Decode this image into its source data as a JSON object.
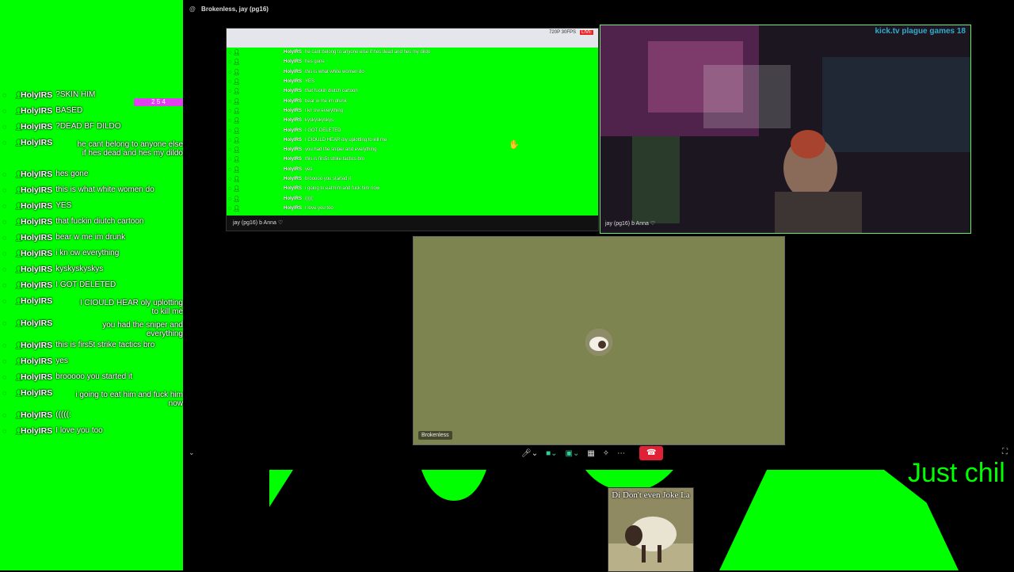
{
  "window": {
    "title": "Brokenless, jay (pg16)"
  },
  "left_chat": {
    "badge_text": "2 5 4",
    "messages": [
      {
        "user": "HolyIRS",
        "text": "?SKIN HIM"
      },
      {
        "user": "HolyIRS",
        "text": "BASED"
      },
      {
        "user": "HolyIRS",
        "text": "?DEAD BF DILDO"
      },
      {
        "user": "HolyIRS",
        "text": "he cant belong to anyone else if hes dead and hes my dildo"
      },
      {
        "user": "HolyIRS",
        "text": "hes gone"
      },
      {
        "user": "HolyIRS",
        "text": "this is what white women do"
      },
      {
        "user": "HolyIRS",
        "text": "YES"
      },
      {
        "user": "HolyIRS",
        "text": "that fuckin diutch cartoon"
      },
      {
        "user": "HolyIRS",
        "text": "bear w me im drunk"
      },
      {
        "user": "HolyIRS",
        "text": "i kn ow everything"
      },
      {
        "user": "HolyIRS",
        "text": "kyskyskyskys"
      },
      {
        "user": "HolyIRS",
        "text": "I GOT DELETED"
      },
      {
        "user": "HolyIRS",
        "text": "I CIOULD HEAR oly uplotting to kill me"
      },
      {
        "user": "HolyIRS",
        "text": "you had the sniper and everything"
      },
      {
        "user": "HolyIRS",
        "text": "this is firs5t strike tactics bro"
      },
      {
        "user": "HolyIRS",
        "text": "yes"
      },
      {
        "user": "HolyIRS",
        "text": "brooooo you started it"
      },
      {
        "user": "HolyIRS",
        "text": "i going to eat him and fuck him now"
      },
      {
        "user": "HolyIRS",
        "text": "(((((:"
      },
      {
        "user": "HolyIRS",
        "text": "I love you too"
      }
    ]
  },
  "shared_screen": {
    "fps_text": "720P 30FPS",
    "live_text": "LIVE",
    "footer_label": "jay (pg16) b Anna ♡",
    "messages": [
      {
        "user": "HolyIRS",
        "text": "he cant belong to anyone else if hes dead and hes my dildo"
      },
      {
        "user": "HolyIRS",
        "text": "hes gone"
      },
      {
        "user": "HolyIRS",
        "text": "this is what white women do"
      },
      {
        "user": "HolyIRS",
        "text": "YES"
      },
      {
        "user": "HolyIRS",
        "text": "that fuckin diutch cartoon"
      },
      {
        "user": "HolyIRS",
        "text": "bear w me im drunk"
      },
      {
        "user": "HolyIRS",
        "text": "i kn ow everything"
      },
      {
        "user": "HolyIRS",
        "text": "kyskyskyskys"
      },
      {
        "user": "HolyIRS",
        "text": "I GOT DELETED"
      },
      {
        "user": "HolyIRS",
        "text": "I CIOULD HEAR oly uplotting to kill me"
      },
      {
        "user": "HolyIRS",
        "text": "you had the sniper and everything"
      },
      {
        "user": "HolyIRS",
        "text": "this is firs5t strike tactics bro"
      },
      {
        "user": "HolyIRS",
        "text": "yes"
      },
      {
        "user": "HolyIRS",
        "text": "brooooo you started it"
      },
      {
        "user": "HolyIRS",
        "text": "i going to eat him and fuck him now"
      },
      {
        "user": "HolyIRS",
        "text": "(((((:"
      },
      {
        "user": "HolyIRS",
        "text": "I love you too"
      }
    ]
  },
  "webcam": {
    "label": "jay (pg16) b Anna ♡",
    "overlay_text": "kick.tv plague games 18"
  },
  "participant_tile": {
    "name": "Brokenless"
  },
  "overlay": {
    "banner_text": "Just chil",
    "card_caption": "Di Don't even Joke La"
  },
  "colors": {
    "chroma_green": "#00ff00",
    "end_call_red": "#e02035",
    "tile_bg": "#7d8450"
  },
  "icons": [
    "microphone-icon",
    "camera-icon",
    "screen-share-icon",
    "grid-icon",
    "effects-icon",
    "more-icon",
    "end-call-icon"
  ]
}
